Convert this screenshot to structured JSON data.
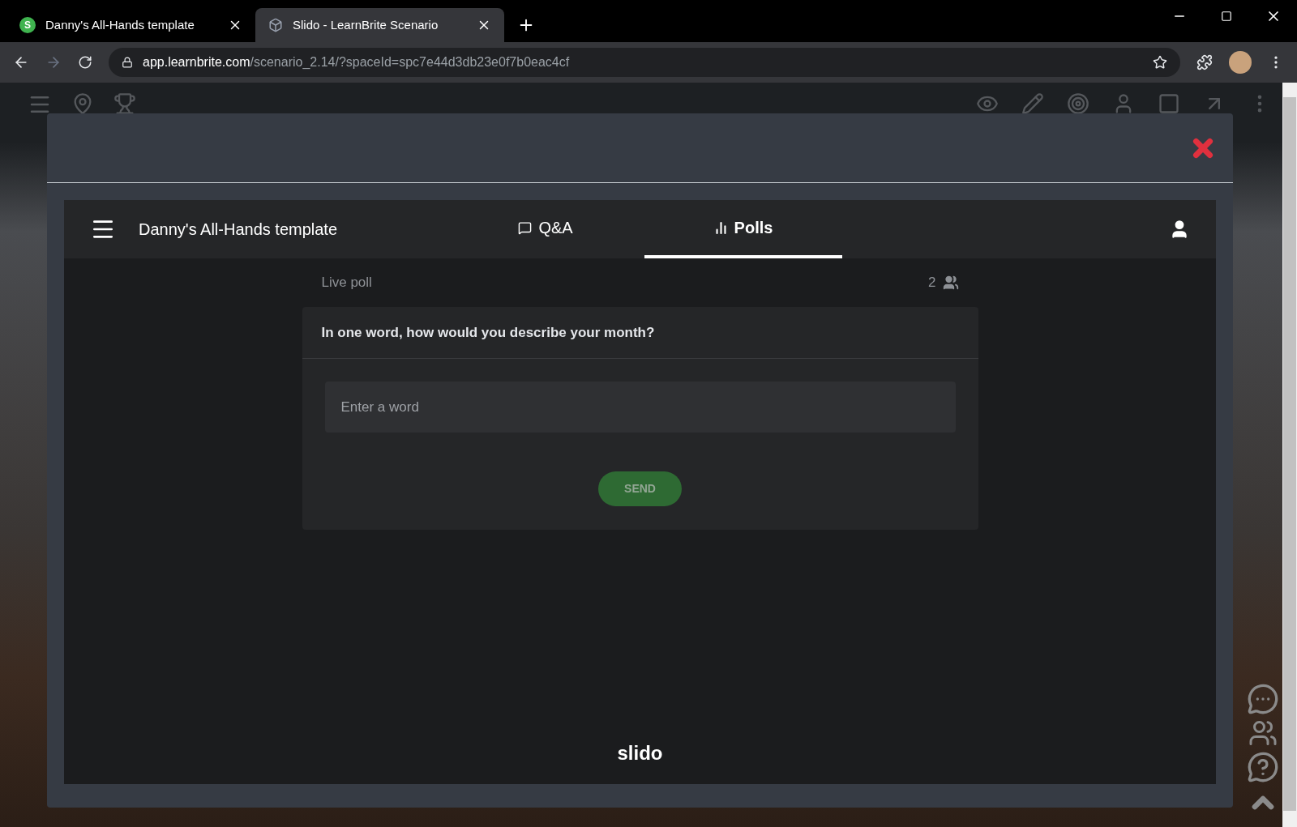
{
  "browser": {
    "tabs": [
      {
        "title": "Danny's All-Hands template",
        "favicon": "S",
        "selected": false
      },
      {
        "title": "Slido - LearnBrite Scenario",
        "selected": true
      }
    ],
    "url_host": "app.learnbrite.com",
    "url_path": "/scenario_2.14/?spaceId=spc7e44d3db23e0f7b0eac4cf"
  },
  "slido": {
    "event_title": "Danny's All-Hands template",
    "tabs": [
      {
        "label": "Q&A",
        "kind": "qa",
        "selected": false
      },
      {
        "label": "Polls",
        "kind": "polls",
        "selected": true
      }
    ],
    "poll_status": "Live poll",
    "participants": "2",
    "question": "In one word, how would you describe your month?",
    "input": {
      "placeholder": "Enter a word"
    },
    "send_button": "SEND",
    "logo": "slido"
  }
}
